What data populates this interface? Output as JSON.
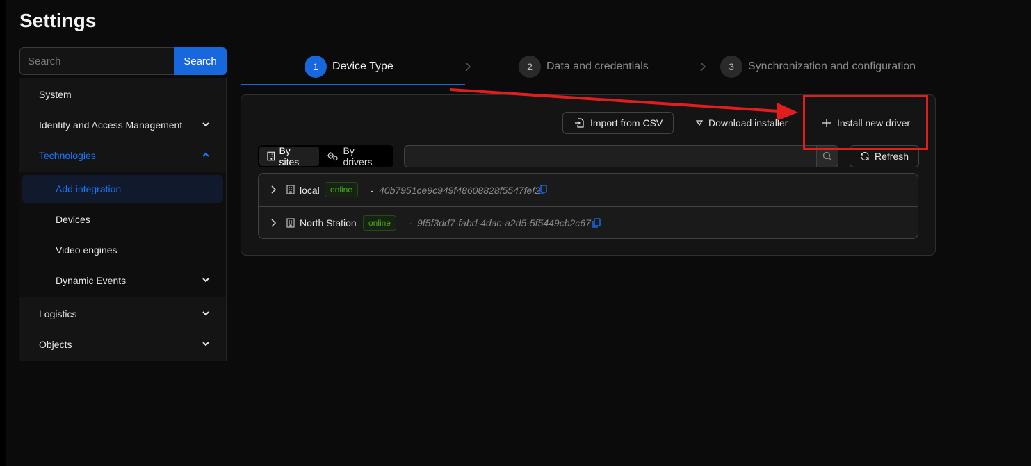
{
  "page": {
    "title": "Settings"
  },
  "search": {
    "placeholder": "Search",
    "button_label": "Search"
  },
  "sidebar": {
    "items": [
      {
        "label": "System"
      },
      {
        "label": "Identity and Access Management"
      },
      {
        "label": "Technologies"
      },
      {
        "label": "Add integration"
      },
      {
        "label": "Devices"
      },
      {
        "label": "Video engines"
      },
      {
        "label": "Dynamic Events"
      },
      {
        "label": "Logistics"
      },
      {
        "label": "Objects"
      }
    ]
  },
  "steps": [
    {
      "number": "1",
      "label": "Device Type"
    },
    {
      "number": "2",
      "label": "Data and credentials"
    },
    {
      "number": "3",
      "label": "Synchronization and configuration"
    }
  ],
  "toolbar": {
    "import_label": "Import from CSV",
    "download_label": "Download installer",
    "install_label": "Install new driver"
  },
  "view_toggle": {
    "by_sites": "By sites",
    "by_drivers": "By drivers"
  },
  "filter": {
    "placeholder": ""
  },
  "refresh_label": "Refresh",
  "sites": [
    {
      "name": "local",
      "status": "online",
      "separator": "-",
      "id": "40b7951ce9c949f48608828f5547fef2"
    },
    {
      "name": "North Station",
      "status": "online",
      "separator": "-",
      "id": "9f5f3dd7-fabd-4dac-a2d5-5f5449cb2c67"
    }
  ],
  "colors": {
    "accent": "#1668dc",
    "online_green": "#49aa19",
    "annotation_red": "#e01e1e",
    "background": "#0b0b0b",
    "panel": "#141414"
  },
  "icons": {
    "chevron": "chevron-down-icon",
    "step_separator": "chevron-right-icon",
    "import": "file-import-icon",
    "download": "caret-down-icon",
    "install": "plus-icon",
    "site": "building-icon",
    "driver": "gears-icon",
    "search": "search-icon",
    "refresh": "refresh-icon",
    "copy": "copy-icon"
  }
}
